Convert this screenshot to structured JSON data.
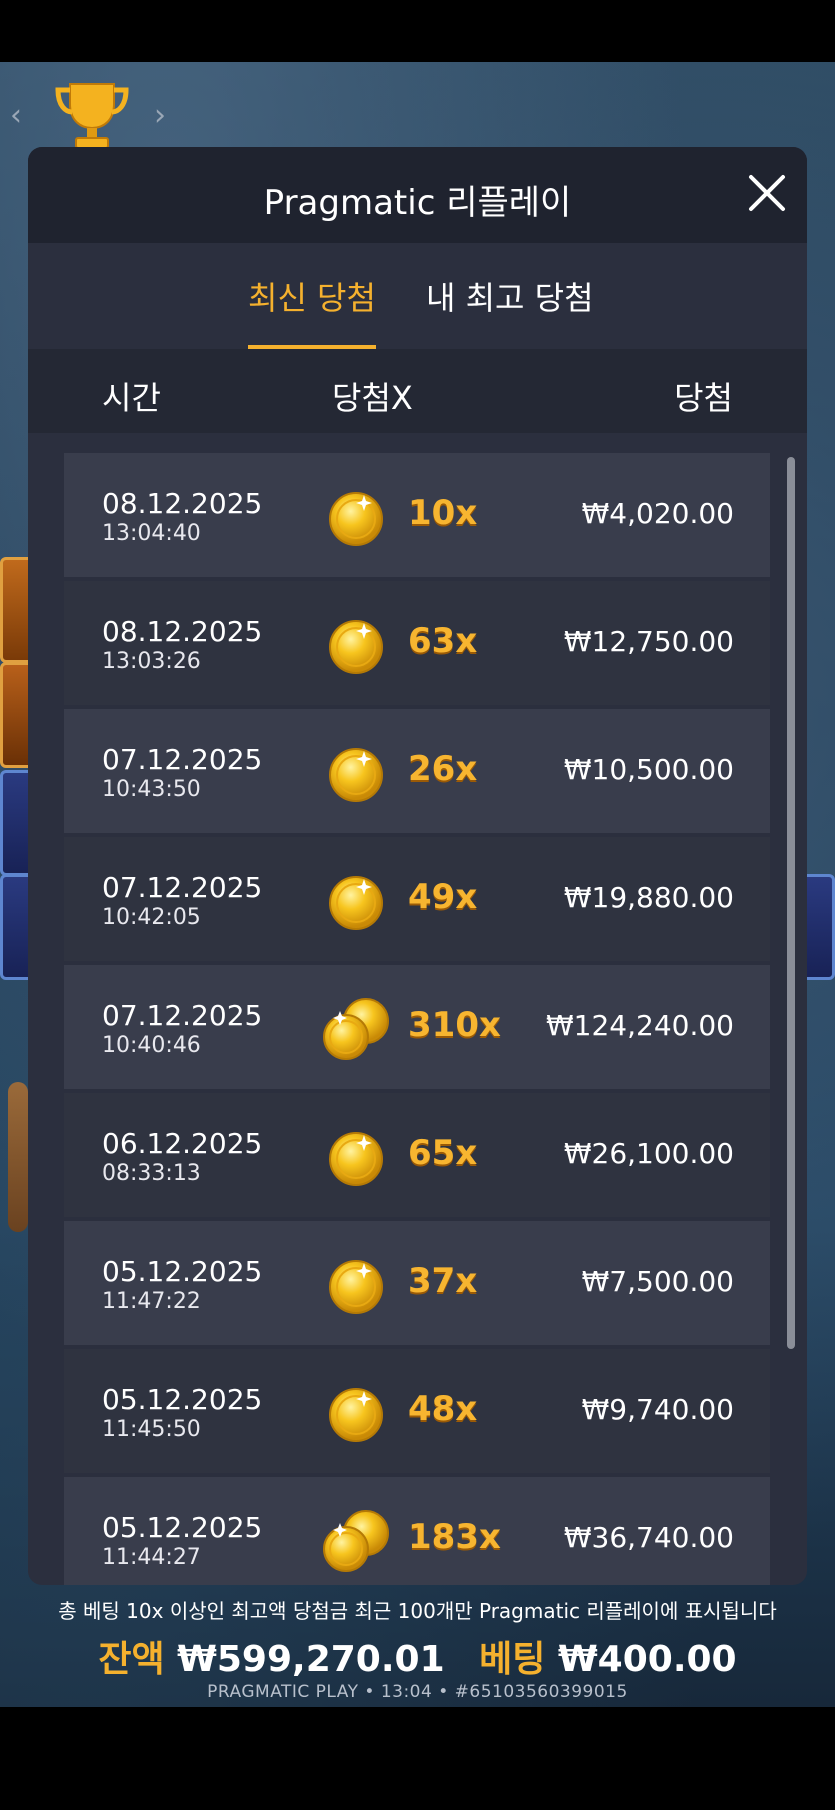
{
  "header": {
    "title": "Pragmatic 리플레이"
  },
  "tabs": [
    {
      "label": "최신 당첨"
    },
    {
      "label": "내 최고 당첨"
    }
  ],
  "columns": {
    "time": "시간",
    "multiplier": "당첨X",
    "win": "당첨"
  },
  "rows": [
    {
      "date": "08.12.2025",
      "time": "13:04:40",
      "mult": "10x",
      "win": "₩4,020.00",
      "coin": "single"
    },
    {
      "date": "08.12.2025",
      "time": "13:03:26",
      "mult": "63x",
      "win": "₩12,750.00",
      "coin": "single"
    },
    {
      "date": "07.12.2025",
      "time": "10:43:50",
      "mult": "26x",
      "win": "₩10,500.00",
      "coin": "single"
    },
    {
      "date": "07.12.2025",
      "time": "10:42:05",
      "mult": "49x",
      "win": "₩19,880.00",
      "coin": "single"
    },
    {
      "date": "07.12.2025",
      "time": "10:40:46",
      "mult": "310x",
      "win": "₩124,240.00",
      "coin": "double"
    },
    {
      "date": "06.12.2025",
      "time": "08:33:13",
      "mult": "65x",
      "win": "₩26,100.00",
      "coin": "single"
    },
    {
      "date": "05.12.2025",
      "time": "11:47:22",
      "mult": "37x",
      "win": "₩7,500.00",
      "coin": "single"
    },
    {
      "date": "05.12.2025",
      "time": "11:45:50",
      "mult": "48x",
      "win": "₩9,740.00",
      "coin": "single"
    },
    {
      "date": "05.12.2025",
      "time": "11:44:27",
      "mult": "183x",
      "win": "₩36,740.00",
      "coin": "double"
    }
  ],
  "footer": {
    "note": "총 베팅 10x 이상인 최고액 당첨금 최근 100개만 Pragmatic 리플레이에 표시됩니다",
    "balance_label": "잔액",
    "balance_value": "₩599,270.01",
    "bet_label": "베팅",
    "bet_value": "₩400.00",
    "brand_line": "PRAGMATIC PLAY • 13:04 • #65103560399015"
  },
  "colors": {
    "accent": "#f5b12e",
    "panel": "#2b2f3e",
    "header": "#1f232f"
  }
}
